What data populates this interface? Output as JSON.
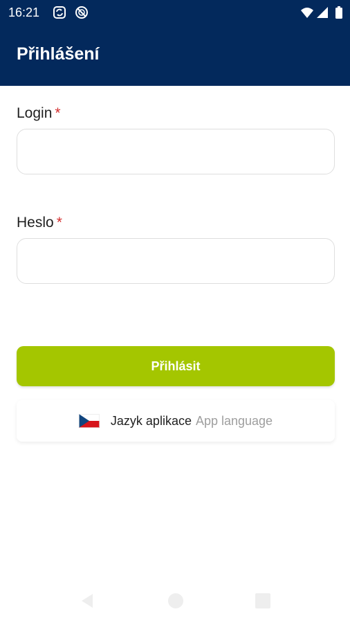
{
  "status_bar": {
    "time": "16:21",
    "left_icons": [
      "sync-icon",
      "blocked-icon"
    ],
    "right_icons": [
      "wifi-icon",
      "signal-icon",
      "battery-icon"
    ]
  },
  "app_bar": {
    "title": "Přihlášení"
  },
  "form": {
    "login": {
      "label": "Login",
      "required_mark": "*",
      "value": "",
      "placeholder": ""
    },
    "password": {
      "label": "Heslo",
      "required_mark": "*",
      "value": "",
      "placeholder": ""
    },
    "submit_label": "Přihlásit"
  },
  "language": {
    "flag_icon": "czech-flag-icon",
    "label_primary": "Jazyk aplikace",
    "label_secondary": "App language"
  },
  "nav_bar": {
    "icons": [
      "back-icon",
      "home-icon",
      "recents-icon"
    ]
  },
  "colors": {
    "header_bg": "#03295c",
    "button_bg": "#a4c600",
    "required": "#d32f2f",
    "secondary_text": "#9e9e9e"
  }
}
